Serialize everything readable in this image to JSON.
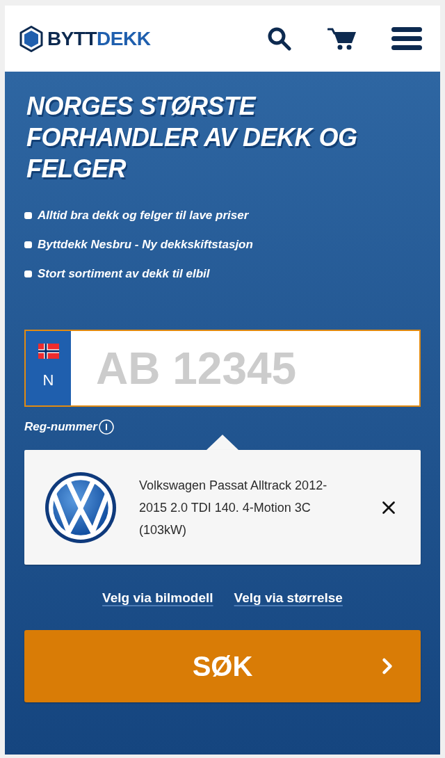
{
  "header": {
    "logo": {
      "part_1": "BYTT",
      "part_2": "DEKK"
    }
  },
  "hero": {
    "title": "NORGES STØRSTE FORHANDLER AV DEKK OG FELGER",
    "bullets": [
      "Alltid bra dekk og felger til lave priser",
      "Byttdekk Nesbru - Ny dekkskiftstasjon",
      "Stort sortiment av dekk til elbil"
    ]
  },
  "search": {
    "plate": {
      "country_code": "N",
      "placeholder": "AB 12345"
    },
    "field_label": "Reg-nummer",
    "vehicle": {
      "name": "Volkswagen Passat Alltrack 2012-2015 2.0 TDI 140. 4-Motion 3C (103kW)"
    },
    "links": [
      "Velg via bilmodell",
      "Velg via størrelse"
    ],
    "submit_label": "SØK"
  }
}
